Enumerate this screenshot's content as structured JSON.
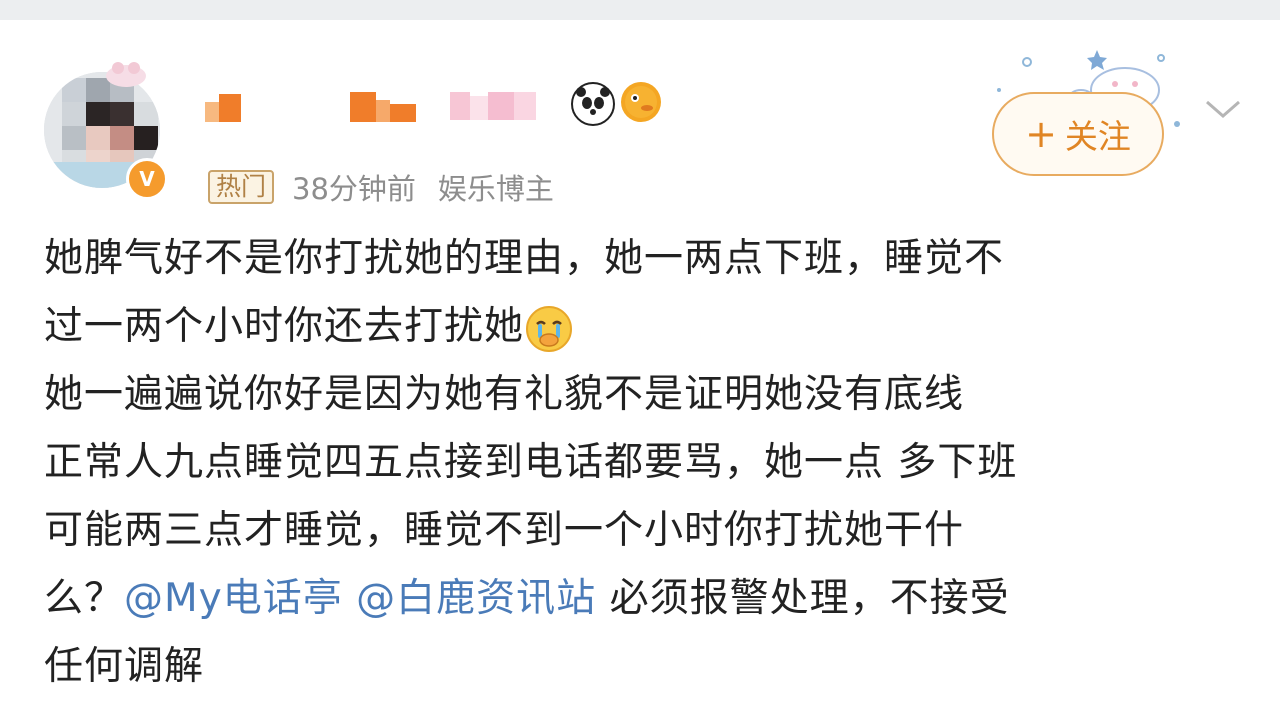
{
  "header": {
    "username_emojis": [
      "panda-emoji",
      "pufferfish-emoji"
    ],
    "hot_tag": "热门",
    "time": "38分钟前",
    "identity": "娱乐博主",
    "follow_label": "关注",
    "follow_icon": "plus-icon",
    "menu_icon": "chevron-down-icon",
    "accent_color": "#e08524"
  },
  "post": {
    "line1": "她脾气好不是你打扰她的理由，她一两点下班，睡觉不",
    "line2": "过一两个小时你还去打扰她",
    "line2_emoji": "crying-face-emoji",
    "line3": "她一遍遍说你好是因为她有礼貌不是证明她没有底线",
    "line4": "正常人九点睡觉四五点接到电话都要骂，她一点 多下班",
    "line5": "可能两三点才睡觉，睡觉不到一个小时你打扰她干什",
    "line6_pre": "么？",
    "mention1": "@My电话亭",
    "mention2": "@白鹿资讯站",
    "line6_post": "必须报警处理，不接受",
    "line7": "任何调解",
    "mention_color": "#4a7bb8"
  }
}
